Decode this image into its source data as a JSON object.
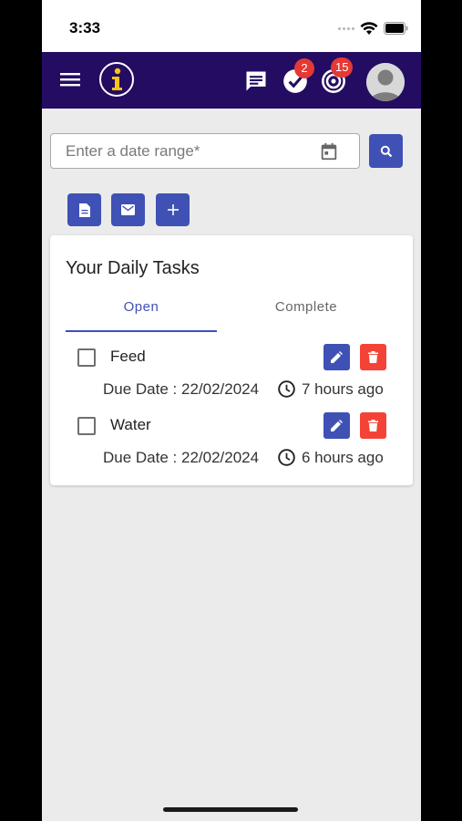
{
  "status_bar": {
    "time": "3:33"
  },
  "header": {
    "tasks_badge": "2",
    "goals_badge": "15"
  },
  "filter": {
    "date_range_placeholder": "Enter a date range*"
  },
  "card": {
    "title": "Your Daily Tasks",
    "tabs": [
      {
        "label": "Open",
        "active": true
      },
      {
        "label": "Complete",
        "active": false
      }
    ],
    "tasks": [
      {
        "name": "Feed",
        "due": "Due Date : 22/02/2024",
        "ago": "7 hours ago",
        "checked": false
      },
      {
        "name": "Water",
        "due": "Due Date : 22/02/2024",
        "ago": "6 hours ago",
        "checked": false
      }
    ]
  },
  "colors": {
    "app_bar": "#240c62",
    "primary": "#3f51b5",
    "danger": "#f44336",
    "badge": "#e53935",
    "logo_accent": "#f5c518"
  },
  "icons": {
    "menu": "menu-icon",
    "logo": "info-logo-icon",
    "chat": "chat-icon",
    "tasks": "check-circle-icon",
    "goals": "target-icon",
    "avatar": "user-avatar-icon",
    "calendar": "calendar-icon",
    "search": "search-icon",
    "report": "document-icon",
    "email": "email-icon",
    "add": "plus-icon",
    "edit": "pencil-icon",
    "delete": "trash-icon",
    "clock": "clock-icon"
  }
}
